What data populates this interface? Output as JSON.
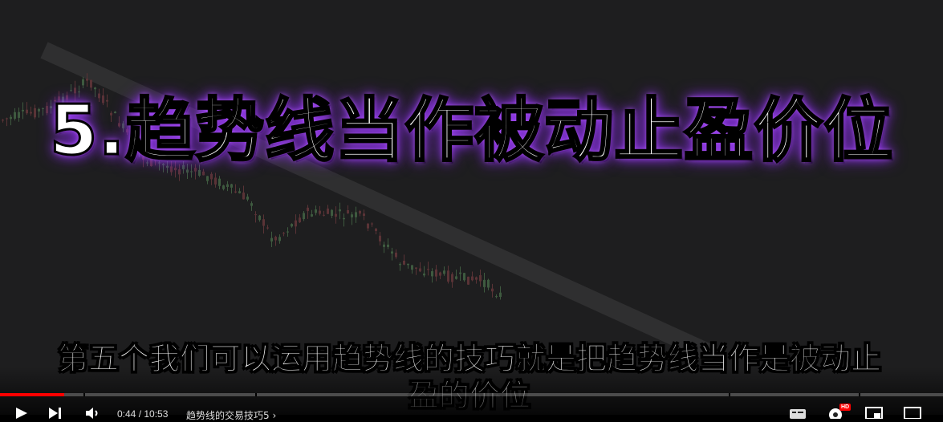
{
  "video": {
    "title_overlay": "5.趋势线当作被动止盈价位",
    "subtitle": "第五个我们可以运用趋势线的技巧就是把趋势线当作是被动止盈的价位",
    "background_color": "#1e1e1f",
    "title_glow_color": "#9b3dff"
  },
  "player": {
    "progress_played": 0.068,
    "played_color": "#ff0000",
    "time_display": "0:44 / 10:53",
    "chapter_title": "趋势线的交易技巧5 ›",
    "hd_badge": "HD",
    "icons": [
      "play-icon",
      "next-icon",
      "volume-icon",
      "subtitles-icon",
      "settings-icon",
      "miniplayer-icon",
      "theater-mode-icon"
    ]
  }
}
